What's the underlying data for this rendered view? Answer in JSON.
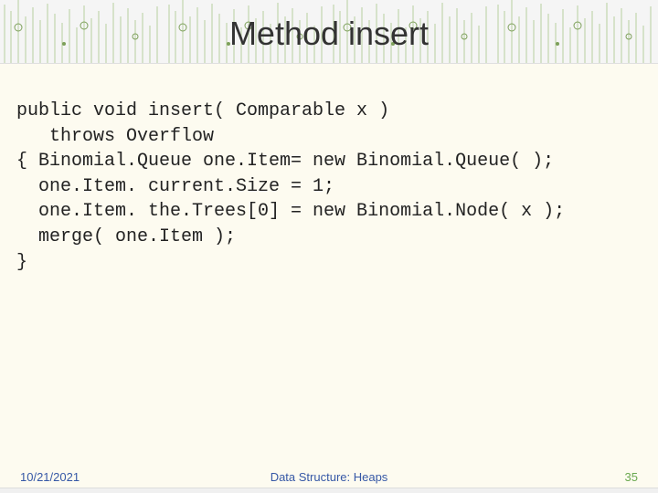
{
  "title": "Method insert",
  "code_lines": [
    "public void insert( Comparable x )",
    "   throws Overflow",
    "{ Binomial.Queue one.Item= new Binomial.Queue( );",
    "  one.Item. current.Size = 1;",
    "  one.Item. the.Trees[0] = new Binomial.Node( x );",
    "  merge( one.Item );",
    "}"
  ],
  "footer": {
    "date": "10/21/2021",
    "center": "Data Structure: Heaps",
    "page": "35"
  }
}
